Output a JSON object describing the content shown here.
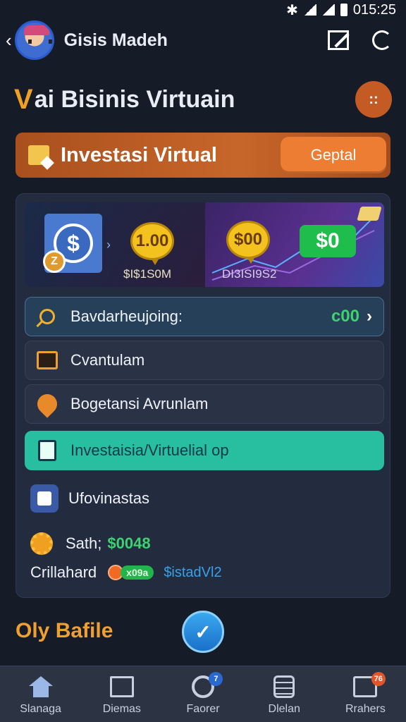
{
  "status_bar": {
    "time": "015:25"
  },
  "app_bar": {
    "back": "‹",
    "title": "Gisis Madeh"
  },
  "section": {
    "title": "ai Bisinis Virtuain",
    "title_prefix": "V",
    "round_btn": "::"
  },
  "banner": {
    "label": "Investasi Virtual",
    "cta": "Geptal"
  },
  "hero": {
    "left_bubble": "1.00",
    "left_caption": "$I$1S0M",
    "right_bubble": "$00",
    "right_green": "$0",
    "right_caption": "DI3ISI9S2",
    "mini_coin": "Z",
    "dollar": "$"
  },
  "rows": [
    {
      "label": "Bavdarheujoing:",
      "value": "c00",
      "chevron": "›",
      "icon": "search-icon"
    },
    {
      "label": "Cvantulam",
      "icon": "frame-icon"
    },
    {
      "label": "Bogetansi Avrunlam",
      "icon": "pin-icon"
    },
    {
      "label": "Investaisia/Virtuelial op",
      "icon": "document-icon"
    }
  ],
  "plain": {
    "item1": "Ufovinastas",
    "item2_label": "Sath;",
    "item2_money": "$0048",
    "item3_label": "Crillahard",
    "item3_pill": "x09a",
    "item3_tag": "$istadVl2"
  },
  "footer": {
    "title": "Oly Bafile",
    "fab": "✓"
  },
  "nav": [
    {
      "label": "Slanaga",
      "icon": "home-icon"
    },
    {
      "label": "Diemas",
      "icon": "grid-icon"
    },
    {
      "label": "Faorer",
      "icon": "search-icon",
      "badge": "7"
    },
    {
      "label": "Dlelan",
      "icon": "list-icon"
    },
    {
      "label": "Rrahers",
      "icon": "store-icon",
      "badge": "76"
    }
  ],
  "colors": {
    "accent": "#f0a030",
    "green": "#3fd070",
    "teal": "#27bfa0",
    "banner": "#c8662a"
  }
}
